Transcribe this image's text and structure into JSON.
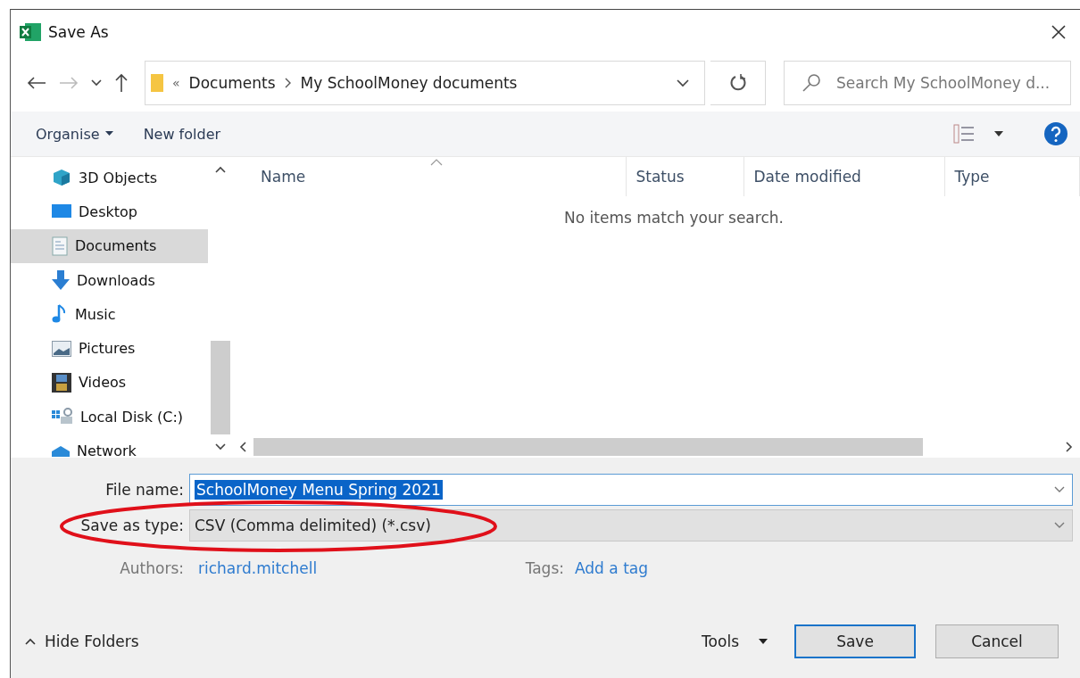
{
  "window": {
    "title": "Save As"
  },
  "address_bar": {
    "overflow": "«",
    "crumbs": [
      "Documents",
      "My SchoolMoney documents"
    ]
  },
  "search": {
    "placeholder": "Search My SchoolMoney d..."
  },
  "toolbar": {
    "organise": "Organise",
    "new_folder": "New folder"
  },
  "sidebar": {
    "items": [
      {
        "label": "3D Objects",
        "kind": "objects",
        "selected": false
      },
      {
        "label": "Desktop",
        "kind": "desktop",
        "selected": false
      },
      {
        "label": "Documents",
        "kind": "documents",
        "selected": true
      },
      {
        "label": "Downloads",
        "kind": "downloads",
        "selected": false
      },
      {
        "label": "Music",
        "kind": "music",
        "selected": false
      },
      {
        "label": "Pictures",
        "kind": "pictures",
        "selected": false
      },
      {
        "label": "Videos",
        "kind": "videos",
        "selected": false
      },
      {
        "label": "Local Disk (C:)",
        "kind": "disk",
        "selected": false
      },
      {
        "label": "Network",
        "kind": "network",
        "selected": false
      }
    ]
  },
  "file_list": {
    "columns": [
      "Name",
      "Status",
      "Date modified",
      "Type"
    ],
    "empty_message": "No items match your search."
  },
  "form": {
    "file_name_label": "File name:",
    "file_name": "SchoolMoney Menu Spring 2021",
    "type_label": "Save as type:",
    "type": "CSV (Comma delimited) (*.csv)",
    "authors_label": "Authors:",
    "author": "richard.mitchell",
    "tags_label": "Tags:",
    "tags_placeholder": "Add a tag"
  },
  "annotation": {
    "kind": "ellipse"
  },
  "footer": {
    "hide_folders": "Hide Folders",
    "tools": "Tools",
    "save": "Save",
    "cancel": "Cancel"
  }
}
